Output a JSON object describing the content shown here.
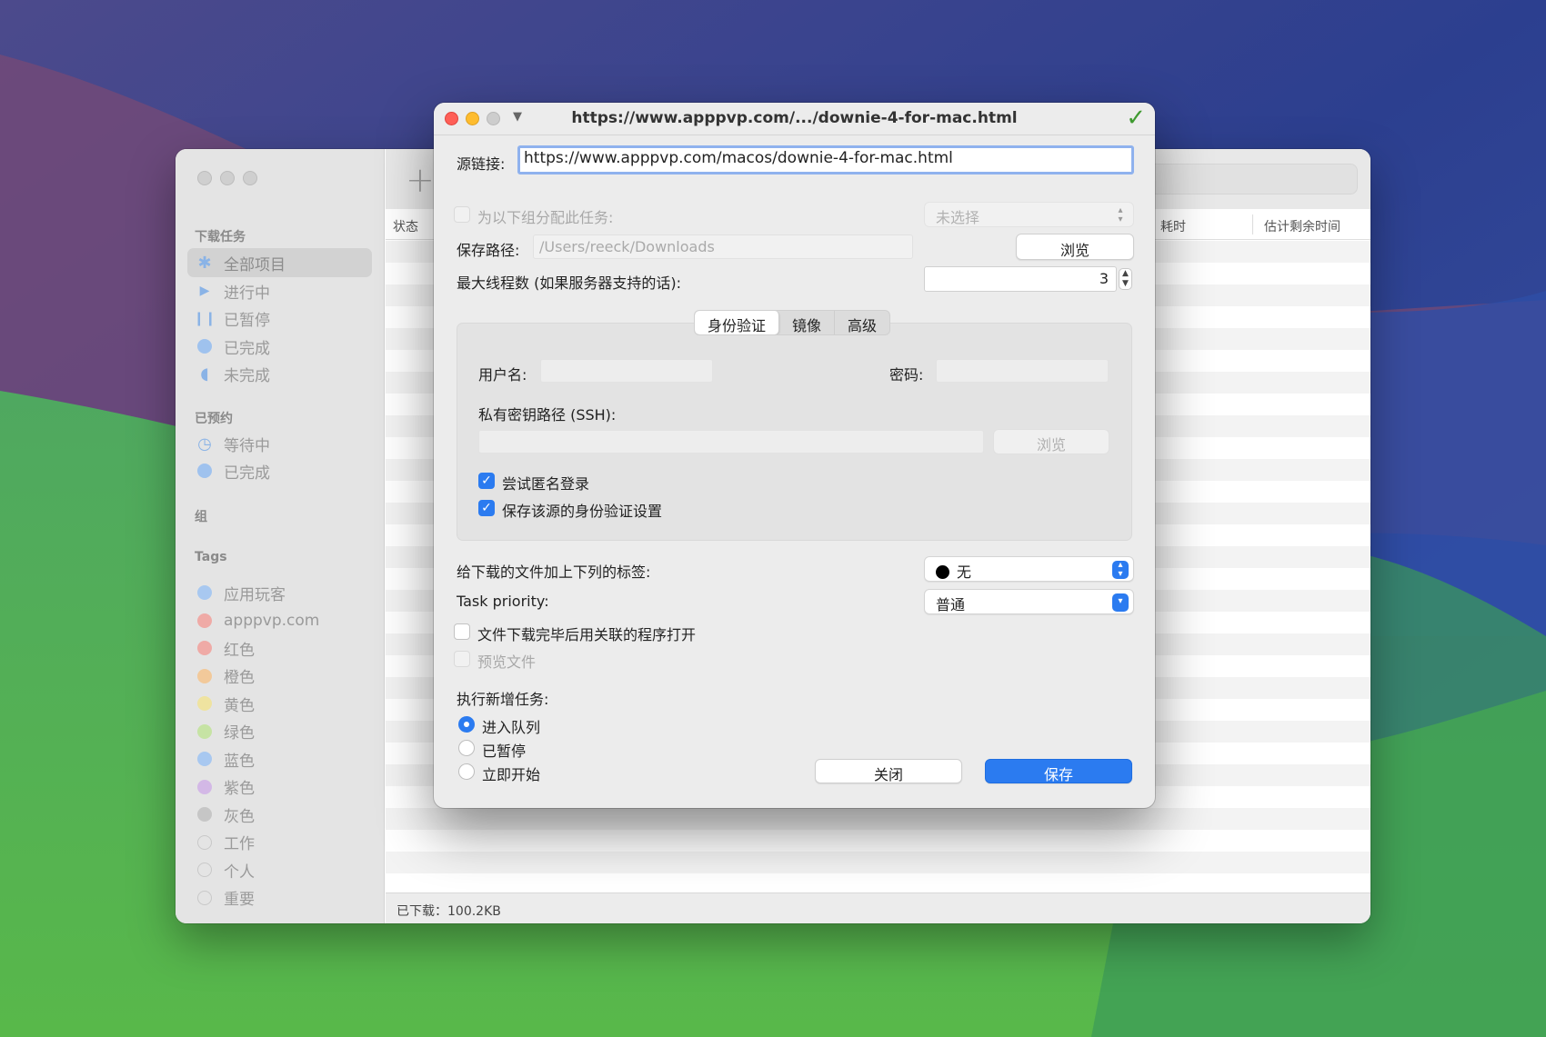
{
  "main": {
    "sidebar": {
      "sections": {
        "downloads": "下载任务",
        "scheduled": "已预约",
        "groups": "组",
        "tags": "Tags"
      },
      "downloads": [
        {
          "label": "全部项目",
          "icon": "asterisk-icon"
        },
        {
          "label": "进行中",
          "icon": "play-icon"
        },
        {
          "label": "已暂停",
          "icon": "pause-icon"
        },
        {
          "label": "已完成",
          "icon": "complete-dot-icon"
        },
        {
          "label": "未完成",
          "icon": "half-moon-icon"
        }
      ],
      "scheduled": [
        {
          "label": "等待中",
          "icon": "clock-icon"
        },
        {
          "label": "已完成",
          "icon": "complete-dot-icon"
        }
      ],
      "tags": [
        {
          "label": "应用玩客",
          "color": "#a8c8f0"
        },
        {
          "label": "apppvp.com",
          "color": "#efaaa6"
        },
        {
          "label": "红色",
          "color": "#efaaa6"
        },
        {
          "label": "橙色",
          "color": "#f2c99a"
        },
        {
          "label": "黄色",
          "color": "#efe3a0"
        },
        {
          "label": "绿色",
          "color": "#c6e3a4"
        },
        {
          "label": "蓝色",
          "color": "#a8c8f0"
        },
        {
          "label": "紫色",
          "color": "#d3b8e6"
        },
        {
          "label": "灰色",
          "color": "#c6c6c6"
        },
        {
          "label": "工作",
          "color": ""
        },
        {
          "label": "个人",
          "color": ""
        },
        {
          "label": "重要",
          "color": ""
        }
      ]
    },
    "columns": {
      "status": "状态",
      "elapsed": "耗时",
      "remaining": "估计剩余时间"
    },
    "statusbar": "已下载：100.2KB"
  },
  "dialog": {
    "title": "https://www.apppvp.com/.../downie-4-for-mac.html",
    "source_label": "源链接:",
    "source_value": "https://www.apppvp.com/macos/downie-4-for-mac.html",
    "assign_group_label": "为以下组分配此任务:",
    "assign_group_value": "未选择",
    "save_path_label": "保存路径:",
    "save_path_value": "/Users/reeck/Downloads",
    "browse": "浏览",
    "max_threads_label": "最大线程数 (如果服务器支持的话):",
    "max_threads_value": "3",
    "tabs": [
      "身份验证",
      "镜像",
      "高级"
    ],
    "auth": {
      "username_label": "用户名:",
      "password_label": "密码:",
      "ssh_label": "私有密钥路径 (SSH):",
      "browse": "浏览",
      "anon_login": "尝试匿名登录",
      "save_auth": "保存该源的身份验证设置"
    },
    "tag_label": "给下载的文件加上下列的标签:",
    "tag_value": "无",
    "priority_label": "Task priority:",
    "priority_value": "普通",
    "open_after": "文件下载完毕后用关联的程序打开",
    "preview": "预览文件",
    "new_task_label": "执行新增任务:",
    "new_task_options": [
      "进入队列",
      "已暂停",
      "立即开始"
    ],
    "close": "关闭",
    "save": "保存",
    "accent": "#2b7bf0"
  }
}
